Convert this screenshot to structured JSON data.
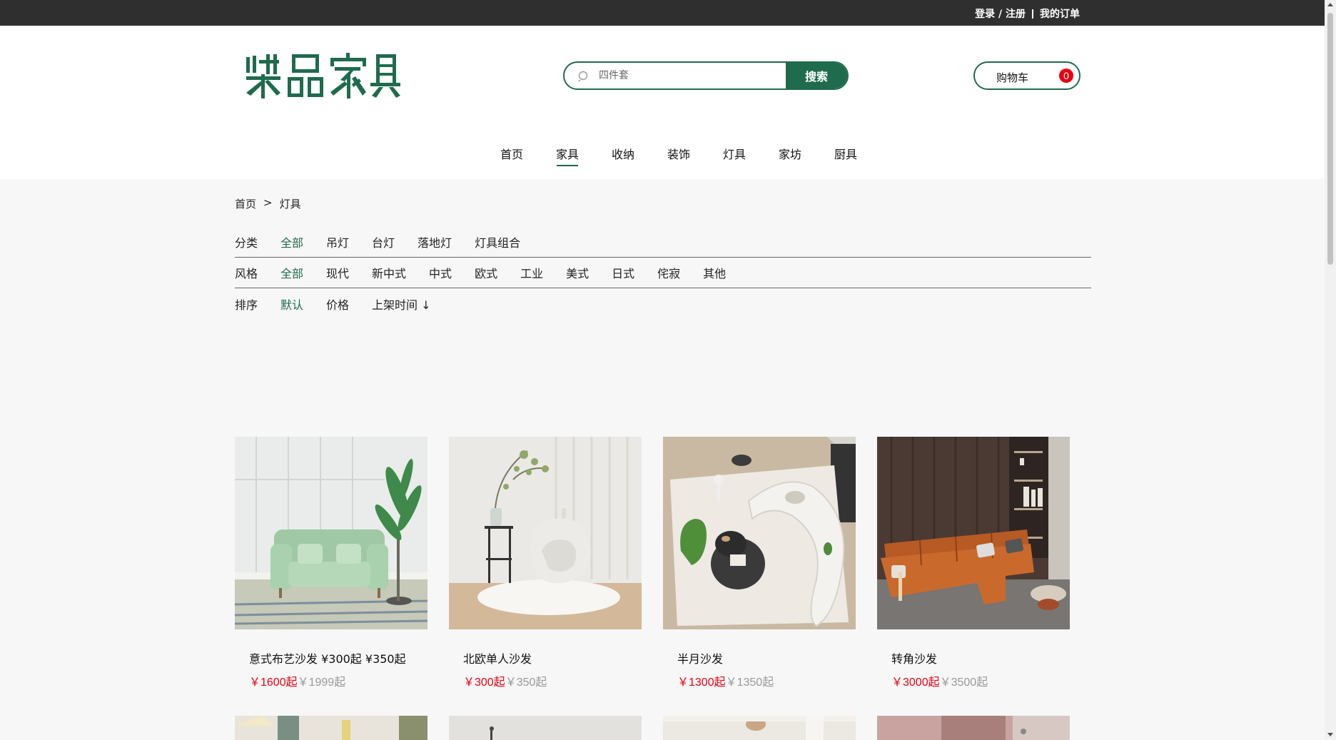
{
  "topbar": {
    "login": "登录 / 注册",
    "orders": "我的订单"
  },
  "logo": {
    "text": "柒品家具",
    "color": "#1f6b4d"
  },
  "search": {
    "placeholder": "四件套",
    "button": "搜索",
    "icon": "search-icon"
  },
  "cart": {
    "label": "购物车",
    "count": "0"
  },
  "nav": {
    "items": [
      "首页",
      "家具",
      "收纳",
      "装饰",
      "灯具",
      "家坊",
      "厨具"
    ],
    "active": "家具"
  },
  "breadcrumb": {
    "home": "首页",
    "sep": ">",
    "current": "灯具"
  },
  "filters": {
    "category": {
      "label": "分类",
      "options": [
        "全部",
        "吊灯",
        "台灯",
        "落地灯",
        "灯具组合"
      ],
      "selected": "全部"
    },
    "style": {
      "label": "风格",
      "options": [
        "全部",
        "现代",
        "新中式",
        "中式",
        "欧式",
        "工业",
        "美式",
        "日式",
        "侘寂",
        "其他"
      ],
      "selected": "全部"
    },
    "sort": {
      "label": "排序",
      "options": [
        "默认",
        "价格",
        "上架时间 ↓"
      ],
      "selected": "默认"
    }
  },
  "products": [
    {
      "name": "意式布艺沙发 ¥300起 ¥350起",
      "price": "￥1600起",
      "old_price": "￥1999起",
      "image": "green-armchair-photo"
    },
    {
      "name": "北欧单人沙发",
      "price": "￥300起",
      "old_price": "￥350起",
      "image": "white-lounge-chair-photo"
    },
    {
      "name": "半月沙发",
      "price": "￥1300起",
      "old_price": "￥1350起",
      "image": "half-moon-sofa-photo"
    },
    {
      "name": "转角沙发",
      "price": "￥3000起",
      "old_price": "￥3500起",
      "image": "leather-corner-sofa-photo"
    }
  ],
  "colors": {
    "brand": "#1f6b4d",
    "price": "#e60012",
    "old_price": "#999999",
    "topbar": "#2f2f2f"
  }
}
